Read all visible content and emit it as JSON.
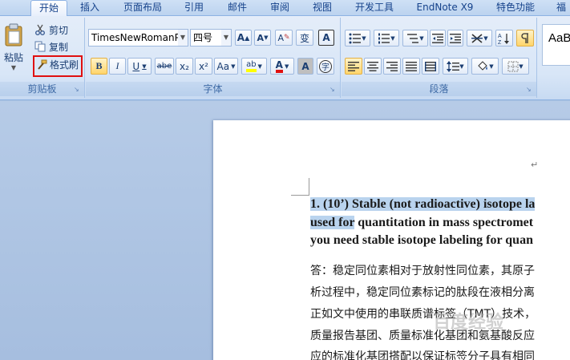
{
  "tabs": [
    "开始",
    "插入",
    "页面布局",
    "引用",
    "邮件",
    "审阅",
    "视图",
    "开发工具",
    "EndNote X9",
    "特色功能",
    "福"
  ],
  "clipboard": {
    "paste_label": "粘贴",
    "cut_label": "剪切",
    "copy_label": "复制",
    "format_painter_label": "格式刷",
    "group_label": "剪贴板"
  },
  "font": {
    "family_value": "TimesNewRomanP",
    "size_value": "四号",
    "grow_label": "A",
    "shrink_label": "A",
    "clear_label": "A",
    "phonetic_label": "变",
    "border_label": "A",
    "bold_label": "B",
    "italic_label": "I",
    "underline_label": "U",
    "strike_label": "abe",
    "subscript_label": "x₂",
    "superscript_label": "x²",
    "case_label": "Aa",
    "highlight_label": "ab",
    "color_label": "A",
    "shade_label": "A",
    "enclose_label": "字",
    "group_label": "字体"
  },
  "paragraph": {
    "group_label": "段落"
  },
  "styles": {
    "preview_text": "AaB"
  },
  "colors": {
    "highlight": "#ffff00",
    "font_color": "#e01010",
    "selection": "#b9d3ee",
    "red_box": "#e01010"
  },
  "document": {
    "question_line1_sel": "1. (10’) Stable (not radioactive) isotope la",
    "question_line2_sel": "used for",
    "question_line2_rest": " quantitation in mass spectromet",
    "question_line3": "you need stable isotope labeling for quan",
    "answer_lines": [
      "答：稳定同位素相对于放射性同位素，其原子",
      "析过程中，稳定同位素标记的肽段在液相分离",
      "正如文中使用的串联质谱标签（TMT）技术，",
      "质量报告基团、质量标准化基团和氨基酸反应",
      "应的标准化基团搭配以保证标签分子具有相同"
    ],
    "return_mark": "↵"
  },
  "watermark": "百度经验"
}
